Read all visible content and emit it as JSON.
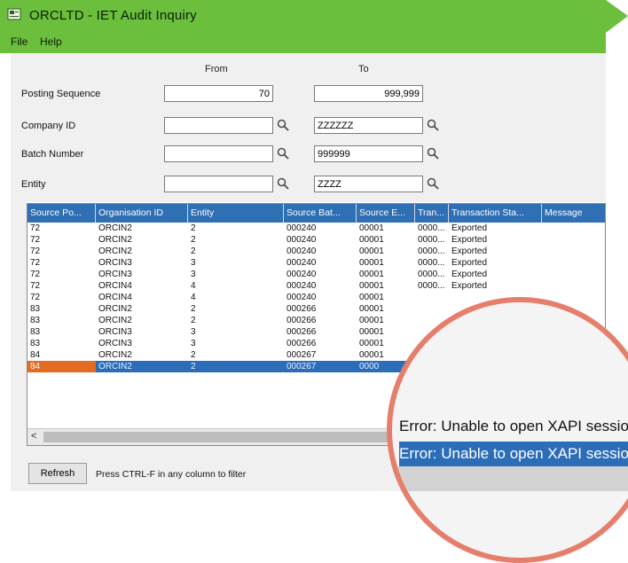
{
  "window": {
    "title": "ORCLTD - IET Audit Inquiry"
  },
  "menu": {
    "file": "File",
    "help": "Help"
  },
  "filter": {
    "from_label": "From",
    "to_label": "To",
    "rows": [
      {
        "label": "Posting Sequence",
        "from": "70",
        "to": "999,999"
      },
      {
        "label": "Company ID",
        "from": "",
        "to": "ZZZZZZ"
      },
      {
        "label": "Batch Number",
        "from": "",
        "to": "999999"
      },
      {
        "label": "Entity",
        "from": "",
        "to": "ZZZZ"
      }
    ]
  },
  "grid": {
    "columns": [
      "Source Po...",
      "Organisation ID",
      "Entity",
      "Source Bat...",
      "Source E...",
      "Tran...",
      "Transaction Sta...",
      "Message"
    ],
    "rows": [
      [
        "72",
        "ORCIN2",
        "2",
        "000240",
        "00001",
        "0000...",
        "Exported",
        ""
      ],
      [
        "72",
        "ORCIN2",
        "2",
        "000240",
        "00001",
        "0000...",
        "Exported",
        ""
      ],
      [
        "72",
        "ORCIN2",
        "2",
        "000240",
        "00001",
        "0000...",
        "Exported",
        ""
      ],
      [
        "72",
        "ORCIN3",
        "3",
        "000240",
        "00001",
        "0000...",
        "Exported",
        ""
      ],
      [
        "72",
        "ORCIN3",
        "3",
        "000240",
        "00001",
        "0000...",
        "Exported",
        ""
      ],
      [
        "72",
        "ORCIN4",
        "4",
        "000240",
        "00001",
        "0000...",
        "Exported",
        ""
      ],
      [
        "72",
        "ORCIN4",
        "4",
        "000240",
        "00001",
        "",
        "",
        ""
      ],
      [
        "83",
        "ORCIN2",
        "2",
        "000266",
        "00001",
        "",
        "",
        ""
      ],
      [
        "83",
        "ORCIN2",
        "2",
        "000266",
        "00001",
        "",
        "",
        ""
      ],
      [
        "83",
        "ORCIN3",
        "3",
        "000266",
        "00001",
        "",
        "",
        ""
      ],
      [
        "83",
        "ORCIN3",
        "3",
        "000266",
        "00001",
        "",
        "",
        ""
      ],
      [
        "84",
        "ORCIN2",
        "2",
        "000267",
        "00001",
        "",
        "",
        ""
      ],
      [
        "84",
        "ORCIN2",
        "2",
        "000267",
        "0000",
        "",
        "",
        ""
      ]
    ],
    "selected_row_index": 12
  },
  "zoom_callout": {
    "line1": "Error: Unable to open XAPI sessio",
    "line2": "Error: Unable to open XAPI sessio"
  },
  "footer": {
    "refresh_label": "Refresh",
    "hint": "Press CTRL-F in any column to filter"
  },
  "colors": {
    "titlebar": "#6bbf3c",
    "grid_header": "#2f6fb3",
    "selection": "#2c6db8",
    "selected_cell": "#e36b22",
    "callout_ring": "#e57f6c"
  },
  "icons": {
    "app": "app-icon",
    "lookup": "magnifier-icon",
    "scroll_left": "scroll-left-arrow"
  }
}
